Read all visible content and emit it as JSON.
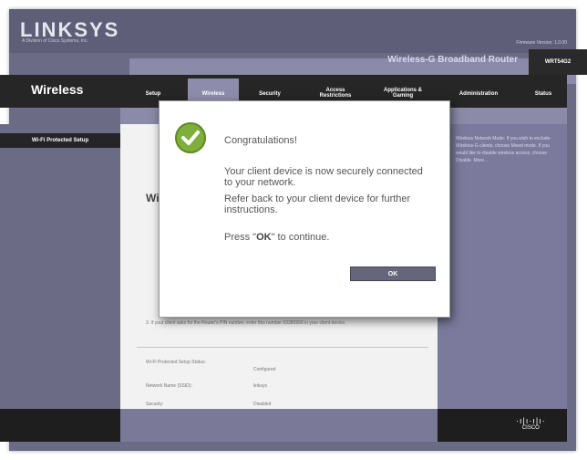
{
  "header": {
    "logo": "LINKSYS",
    "logo_sub": "A Division of Cisco Systems, Inc.",
    "firmware": "Firmware Version: 1.0.00",
    "product_name": "Wireless-G Broadband Router",
    "model": "WRT54G2"
  },
  "nav": {
    "section_title": "Wireless",
    "items": [
      {
        "label": "Setup"
      },
      {
        "label": "Wireless"
      },
      {
        "label": "Security"
      },
      {
        "label": "Access Restrictions"
      },
      {
        "label": "Applications & Gaming"
      },
      {
        "label": "Administration"
      },
      {
        "label": "Status"
      }
    ]
  },
  "sidebar": {
    "items": [
      {
        "label": "Wi-Fi Protected Setup"
      }
    ]
  },
  "content": {
    "heading": "Wi",
    "step3": "3. If your client asks for the Router's PIN number, enter this number 63380990 in your client device.",
    "status_label": "Wi-Fi Protected Setup Status:",
    "status_value": "Configured",
    "ssid_label": "Network Name (SSID):",
    "ssid_value": "linksys",
    "security_label": "Security:",
    "security_value": "Disabled"
  },
  "help": {
    "text": "Wireless Network Mode: If you wish to exclude Wireless-G clients, choose Mixed mode. If you would like to disable wireless access, choose Disable. More..."
  },
  "modal": {
    "title": "Congratulations!",
    "line1": "Your client device is now securely connected",
    "line2": "to your network.",
    "line3": "Refer back to your client device for further",
    "line4": "instructions.",
    "press_prefix": "Press \"",
    "press_ok": "OK",
    "press_suffix": "\" to continue.",
    "ok_button": "OK"
  },
  "footer": {
    "brand": "CISCO"
  },
  "colors": {
    "background": "#6c6b85",
    "nav_bar": "#262626",
    "accent": "#8b8aa8",
    "check_green": "#7fae3c",
    "ok_button": "#66667a"
  }
}
